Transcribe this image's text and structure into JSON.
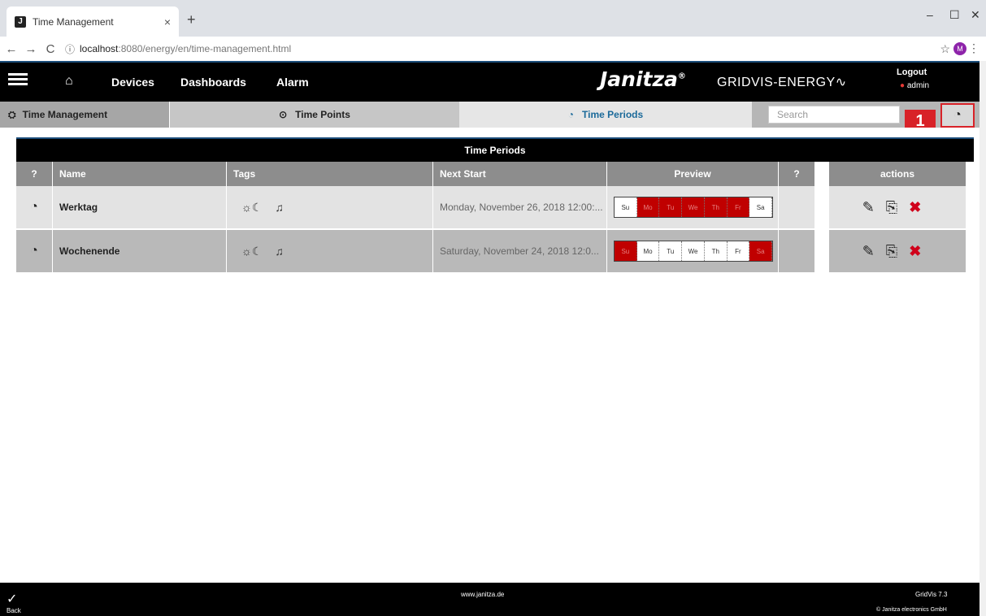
{
  "browser": {
    "tab_title": "Time Management",
    "favicon": "J",
    "close": "×",
    "new_tab": "+",
    "url_host": "localhost",
    "url_path": ":8080/energy/en/time-management.html",
    "window": {
      "minimize": "–",
      "maximize": "☐",
      "close": "✕"
    },
    "profile_initial": "M"
  },
  "header": {
    "nav": [
      "Devices",
      "Dashboards",
      "Alarm"
    ],
    "brand": "Janitza",
    "brand_mark": "®",
    "brand_sub": "GRIDVIS-ENERGY",
    "logout": "Logout",
    "user": "admin"
  },
  "subnav": {
    "time_management": "Time Management",
    "time_points": "Time Points",
    "time_periods": "Time Periods",
    "search_placeholder": "Search"
  },
  "marker": "1",
  "table": {
    "title": "Time Periods",
    "headers": {
      "name": "Name",
      "tags": "Tags",
      "next_start": "Next Start",
      "preview": "Preview",
      "actions": "actions"
    },
    "rows": [
      {
        "name": "Werktag",
        "next_start": "Monday, November 26, 2018 12:00:...",
        "active_days": [
          false,
          true,
          true,
          true,
          true,
          true,
          false
        ]
      },
      {
        "name": "Wochenende",
        "next_start": "Saturday, November 24, 2018 12:0...",
        "active_days": [
          true,
          false,
          false,
          false,
          false,
          false,
          true
        ]
      }
    ],
    "days": [
      "Su",
      "Mo",
      "Tu",
      "We",
      "Th",
      "Fr",
      "Sa"
    ]
  },
  "footer": {
    "back": "Back",
    "site": "www.janitza.de",
    "version": "GridVis 7.3",
    "copyright": "© Janitza electronics GmbH"
  },
  "colors": {
    "accent_red": "#d82228",
    "active_day": "#c00000",
    "header_bg": "#000000",
    "link_blue": "#1b6a9a"
  }
}
